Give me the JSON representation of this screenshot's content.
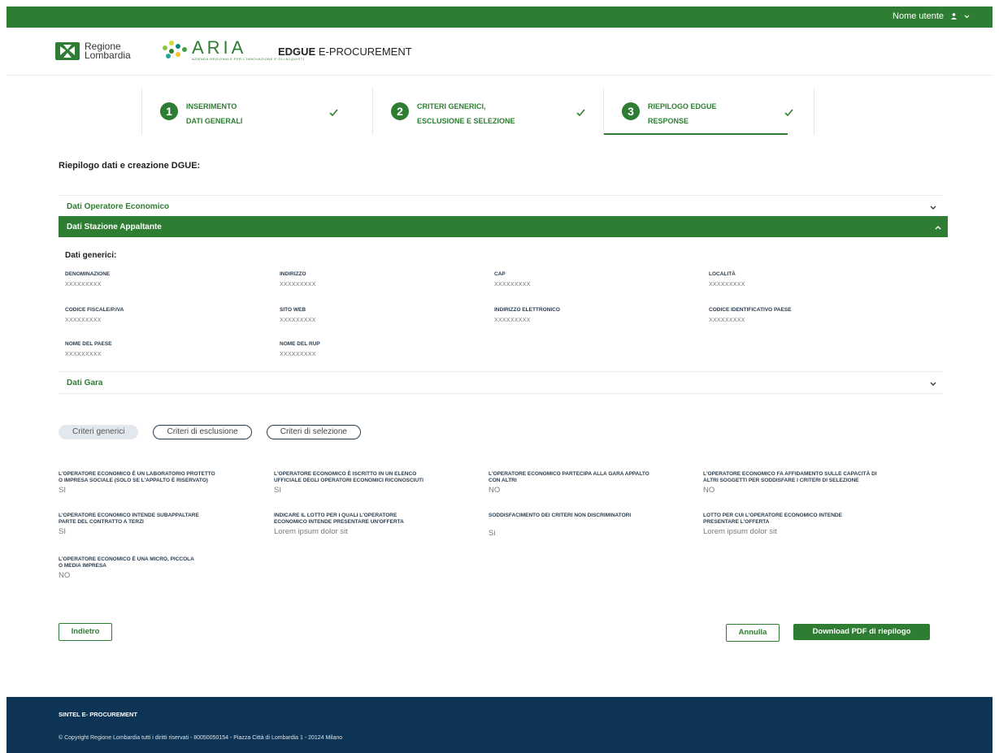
{
  "topbar": {
    "user_label": "Nome utente"
  },
  "header": {
    "logo_regione": [
      "Regione",
      "Lombardia"
    ],
    "logo_aria": "ARIA",
    "logo_aria_sub": "AZIENDA REGIONALE PER L'INNOVAZIONE E GLI ACQUISTI",
    "title_bold": "EDGUE",
    "title_rest": " E-PROCUREMENT"
  },
  "steps": [
    {
      "num": "1",
      "line1": "INSERIMENTO",
      "line2": "DATI GENERALI"
    },
    {
      "num": "2",
      "line1": "CRITERI GENERICI,",
      "line2": "ESCLUSIONE E SELEZIONE"
    },
    {
      "num": "3",
      "line1": "RIEPILOGO EDGUE",
      "line2": "RESPONSE"
    }
  ],
  "section_title": "Riepilogo dati e creazione DGUE:",
  "accordion": {
    "operatore": "Dati Operatore Economico",
    "stazione": "Dati Stazione Appaltante",
    "gara": "Dati Gara"
  },
  "panel": {
    "subtitle": "Dati generici:",
    "fields": [
      {
        "label": "DENOMINAZIONE",
        "value": "XXXXXXXXX"
      },
      {
        "label": "INDIRIZZO",
        "value": "XXXXXXXXX"
      },
      {
        "label": "CAP",
        "value": "XXXXXXXXX"
      },
      {
        "label": "LOCALITÀ",
        "value": "XXXXXXXXX"
      },
      {
        "label": "CODICE FISCALE/P.IVA",
        "value": "XXXXXXXXX"
      },
      {
        "label": "SITO WEB",
        "value": "XXXXXXXXX"
      },
      {
        "label": "INDIRIZZO ELETTRONICO",
        "value": "XXXXXXXXX"
      },
      {
        "label": "CODICE IDENTIFICATIVO PAESE",
        "value": "XXXXXXXXX"
      },
      {
        "label": "NOME DEL PAESE",
        "value": "XXXXXXXXX"
      },
      {
        "label": "NOME DEL RUP",
        "value": "XXXXXXXXX"
      }
    ]
  },
  "tabs": [
    "Criteri generici",
    "Criteri di esclusione",
    "Criteri di selezione"
  ],
  "criteria": [
    {
      "l1": "L'OPERATORE ECONOMICO È UN LABORATORIO PROTETTO",
      "l2": "O IMPRESA SOCIALE (SOLO SE L'APPALTO È RISERVATO)",
      "value": "SI"
    },
    {
      "l1": "L'OPERATORE ECONOMICO È ISCRITTO IN UN ELENCO",
      "l2": "UFFICIALE DEGLI OPERATORI ECONOMICI RICONOSCIUTI",
      "value": "SI"
    },
    {
      "l1": "L'OPERATORE ECONOMICO PARTECIPA ALLA GARA APPALTO",
      "l2": "CON ALTRI",
      "value": "NO"
    },
    {
      "l1": "L'OPERATORE ECONOMICO FA AFFIDAMENTO SULLE CAPACITÀ DI",
      "l2": "ALTRI SOGGETTI PER SODDISFARE I CRITERI DI SELEZIONE",
      "value": "NO"
    },
    {
      "l1": "L'OPERATORE ECONOMICO INTENDE SUBAPPALTARE",
      "l2": "PARTE DEL CONTRATTO A TERZI",
      "value": "SI"
    },
    {
      "l1": "INDICARE IL LOTTO PER I QUALI L'OPERATORE",
      "l2": "ECONOMICO INTENDE PRESENTARE UN'OFFERTA",
      "value": "Lorem ipsum dolor sit"
    },
    {
      "l1": "SODDISFACIMENTO DEI CRITERI NON DISCRIMINATORI",
      "l2": "",
      "value": "Si"
    },
    {
      "l1": "LOTTO PER CUI L'OPERATORE ECONOMICO INTENDE",
      "l2": "PRESENTARE L'OFFERTA",
      "value": "Lorem ipsum dolor sit"
    },
    {
      "l1": "L'OPERATORE ECONOMICO È UNA MICRO, PICCOLA",
      "l2": "O MEDIA IMPRESA",
      "value": "NO"
    }
  ],
  "buttons": {
    "back": "Indietro",
    "cancel": "Annulla",
    "download": "Download PDF di riepilogo"
  },
  "footer": {
    "title": "SINTEL E- PROCUREMENT",
    "copyright": "© Copyright Regione Lombardia tutti i diritti riservati - 80050050154 - Piazza Città di Lombardia 1 - 20124 Milano"
  }
}
